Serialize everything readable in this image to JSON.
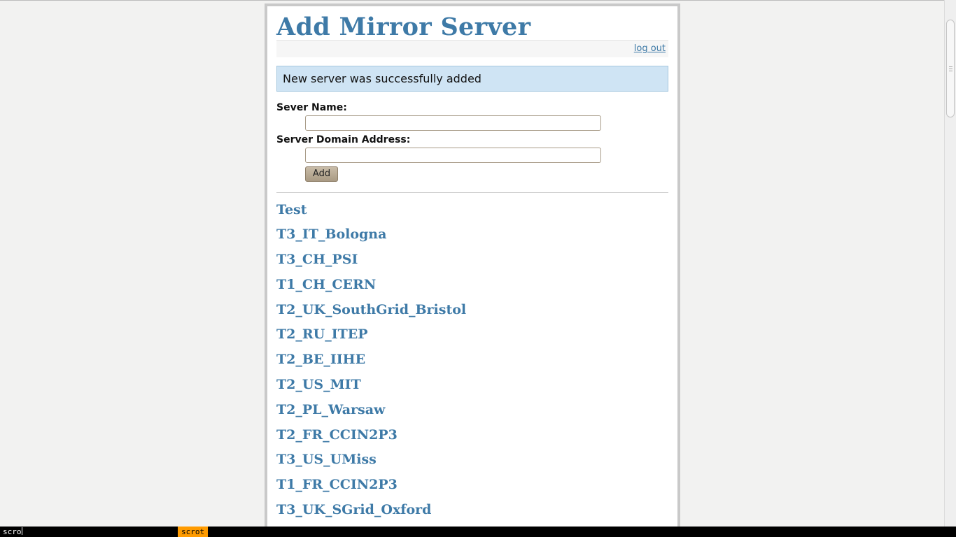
{
  "page": {
    "title": "Add Mirror Server",
    "logout_label": "log out",
    "notice": "New server was successfully added"
  },
  "form": {
    "server_name_label": "Sever Name:",
    "server_name_value": "",
    "domain_label": "Server Domain Address:",
    "domain_value": "",
    "add_label": "Add"
  },
  "servers": [
    "Test",
    "T3_IT_Bologna",
    "T3_CH_PSI",
    "T1_CH_CERN",
    "T2_UK_SouthGrid_Bristol",
    "T2_RU_ITEP",
    "T2_BE_IIHE",
    "T2_US_MIT",
    "T2_PL_Warsaw",
    "T2_FR_CCIN2P3",
    "T3_US_UMiss",
    "T1_FR_CCIN2P3",
    "T3_UK_SGrid_Oxford"
  ],
  "statusbar": {
    "command": "scro",
    "tag": "scrot"
  },
  "colors": {
    "link": "#3e7aa7",
    "notice_bg": "#cfe4f4",
    "status_tag": "#ff9b00"
  }
}
